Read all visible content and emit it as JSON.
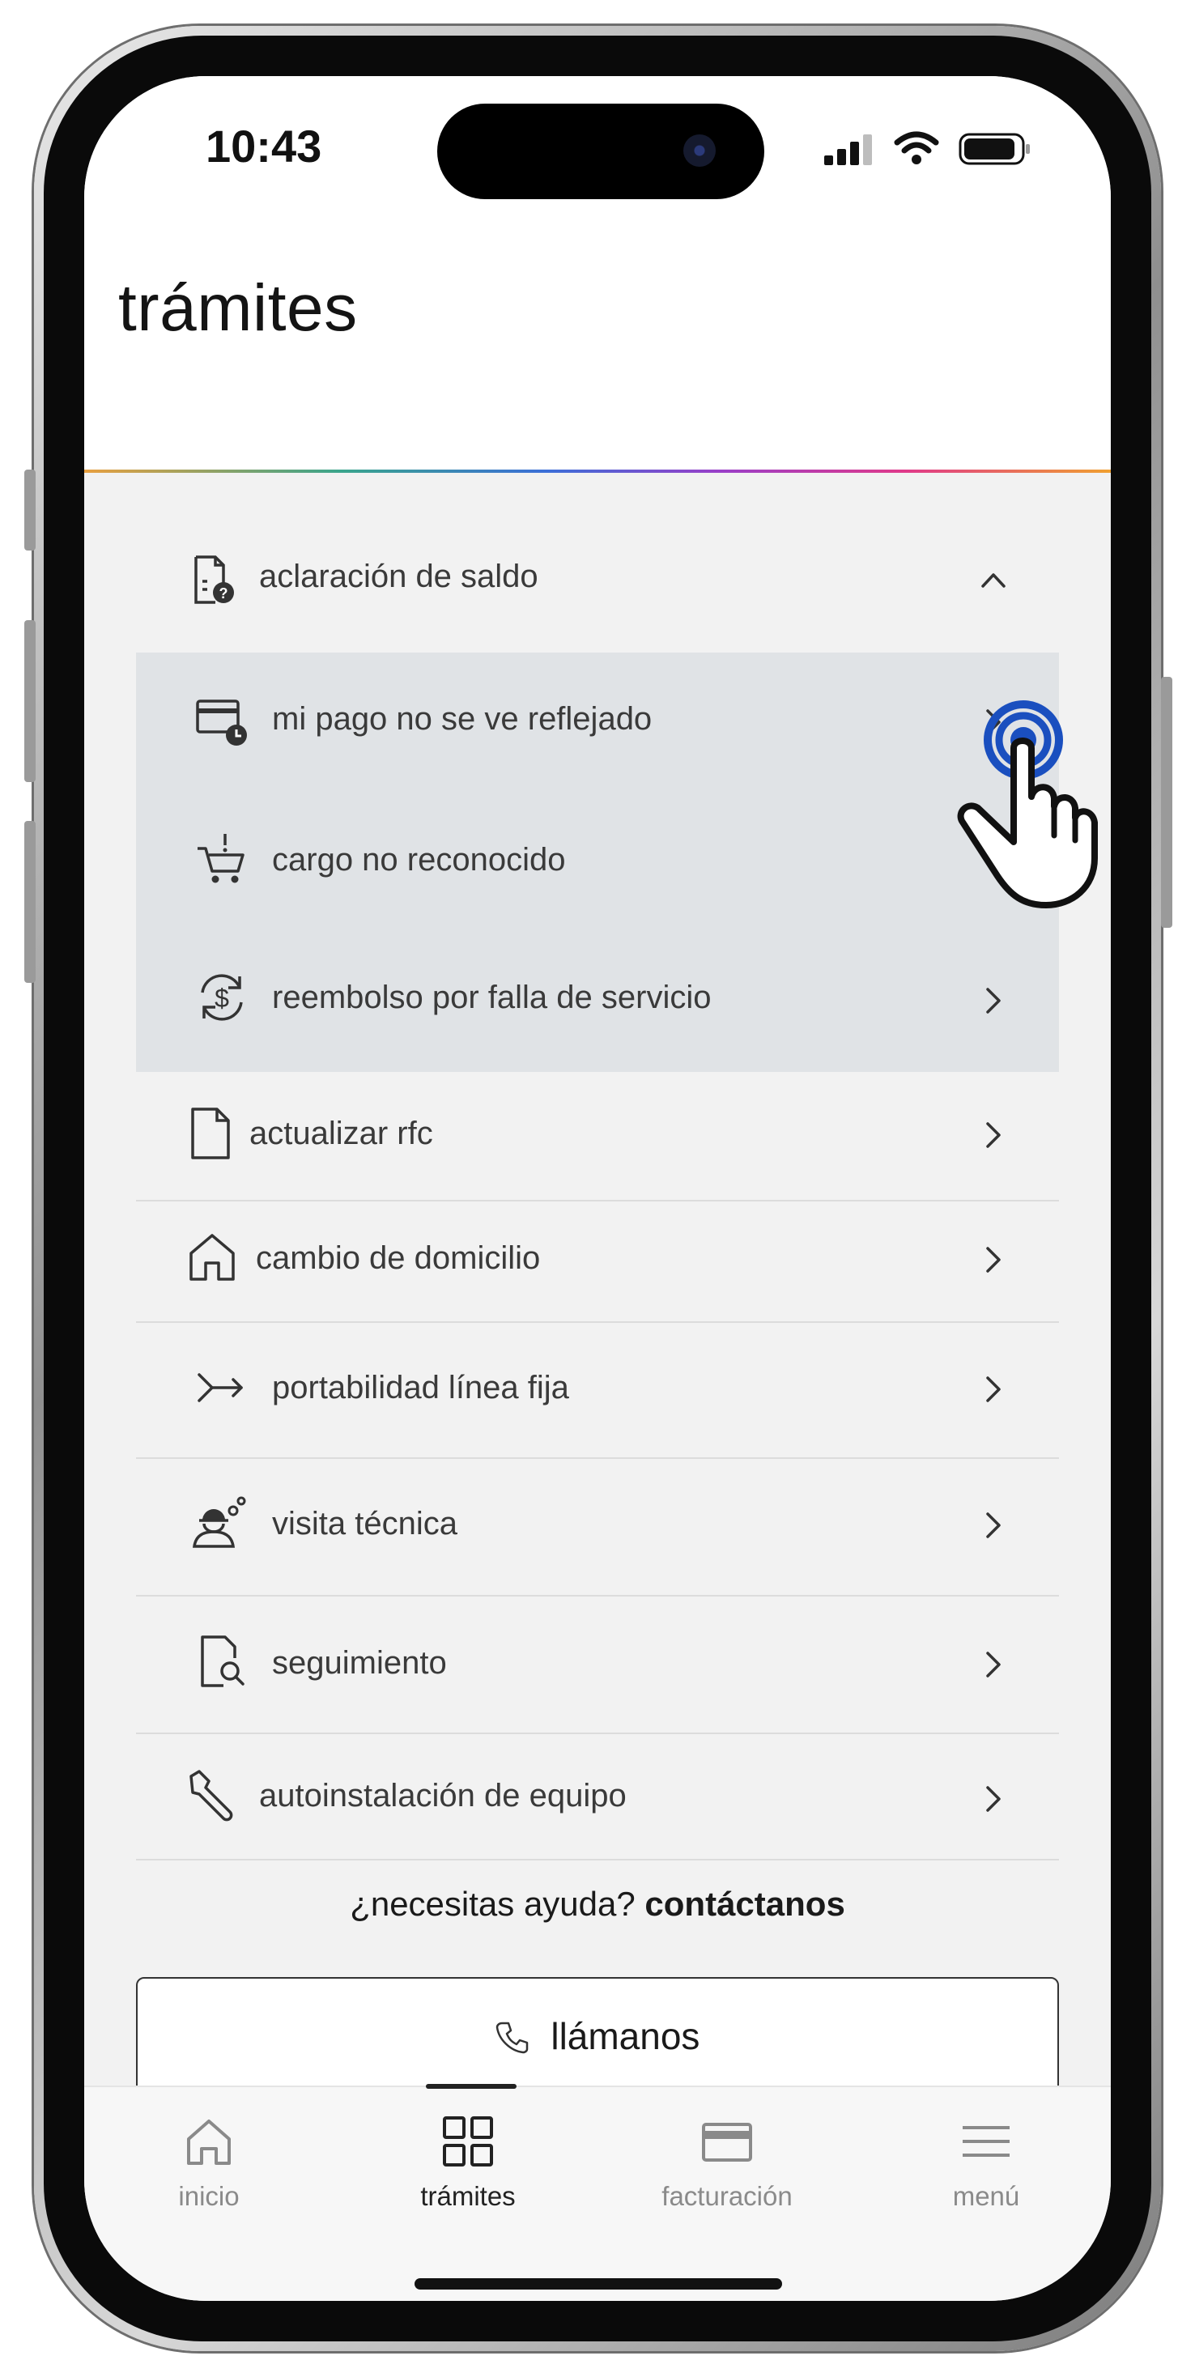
{
  "status_bar": {
    "time": "10:43"
  },
  "header": {
    "title": "trámites"
  },
  "menu": {
    "expanded": {
      "label": "aclaración de saldo",
      "icon": "document-question-icon",
      "sub_items": [
        {
          "label": "mi pago no se ve reflejado",
          "icon": "card-clock-icon"
        },
        {
          "label": "cargo no reconocido",
          "icon": "cart-alert-icon"
        },
        {
          "label": "reembolso por falla de servicio",
          "icon": "refund-dollar-icon"
        }
      ]
    },
    "items": [
      {
        "label": "actualizar rfc",
        "icon": "document-icon"
      },
      {
        "label": "cambio de domicilio",
        "icon": "home-icon"
      },
      {
        "label": "portabilidad línea fija",
        "icon": "merge-arrow-icon"
      },
      {
        "label": "visita técnica",
        "icon": "technician-icon"
      },
      {
        "label": "seguimiento",
        "icon": "document-search-icon"
      },
      {
        "label": "autoinstalación de equipo",
        "icon": "wrench-icon"
      }
    ]
  },
  "help": {
    "question": "¿necesitas ayuda?",
    "link": "contáctanos",
    "call_button": "llámanos"
  },
  "tabbar": {
    "tabs": [
      {
        "label": "inicio",
        "icon": "home-icon"
      },
      {
        "label": "trámites",
        "icon": "grid-icon",
        "active": true
      },
      {
        "label": "facturación",
        "icon": "card-icon"
      },
      {
        "label": "menú",
        "icon": "hamburger-icon"
      }
    ]
  },
  "colors": {
    "accent": "#1a4fbf",
    "submenu_bg": "#e0e3e6",
    "screen_bg": "#f2f2f2"
  }
}
